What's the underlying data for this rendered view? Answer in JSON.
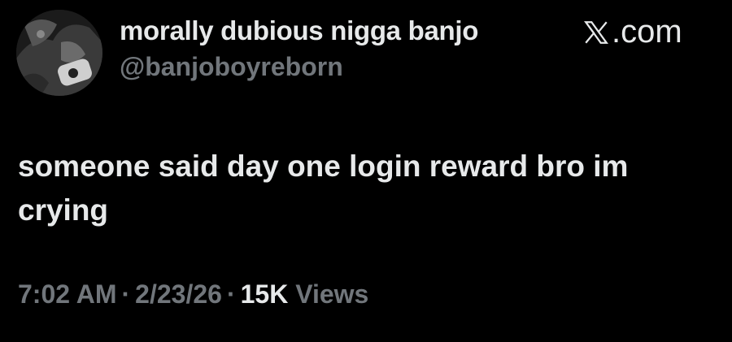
{
  "author": {
    "display_name": "morally dubious nigga banjo",
    "handle": "@banjoboyreborn"
  },
  "brand": {
    "label": ".com",
    "icon": "x-logo-icon"
  },
  "post": {
    "text": "someone said day one login reward bro im crying"
  },
  "meta": {
    "time": "7:02 AM",
    "separator": "·",
    "date": "2/23/26",
    "views_count": "15K",
    "views_label": "Views"
  },
  "colors": {
    "background": "#000000",
    "primary_text": "#e7e9ea",
    "secondary_text": "#71767b"
  }
}
